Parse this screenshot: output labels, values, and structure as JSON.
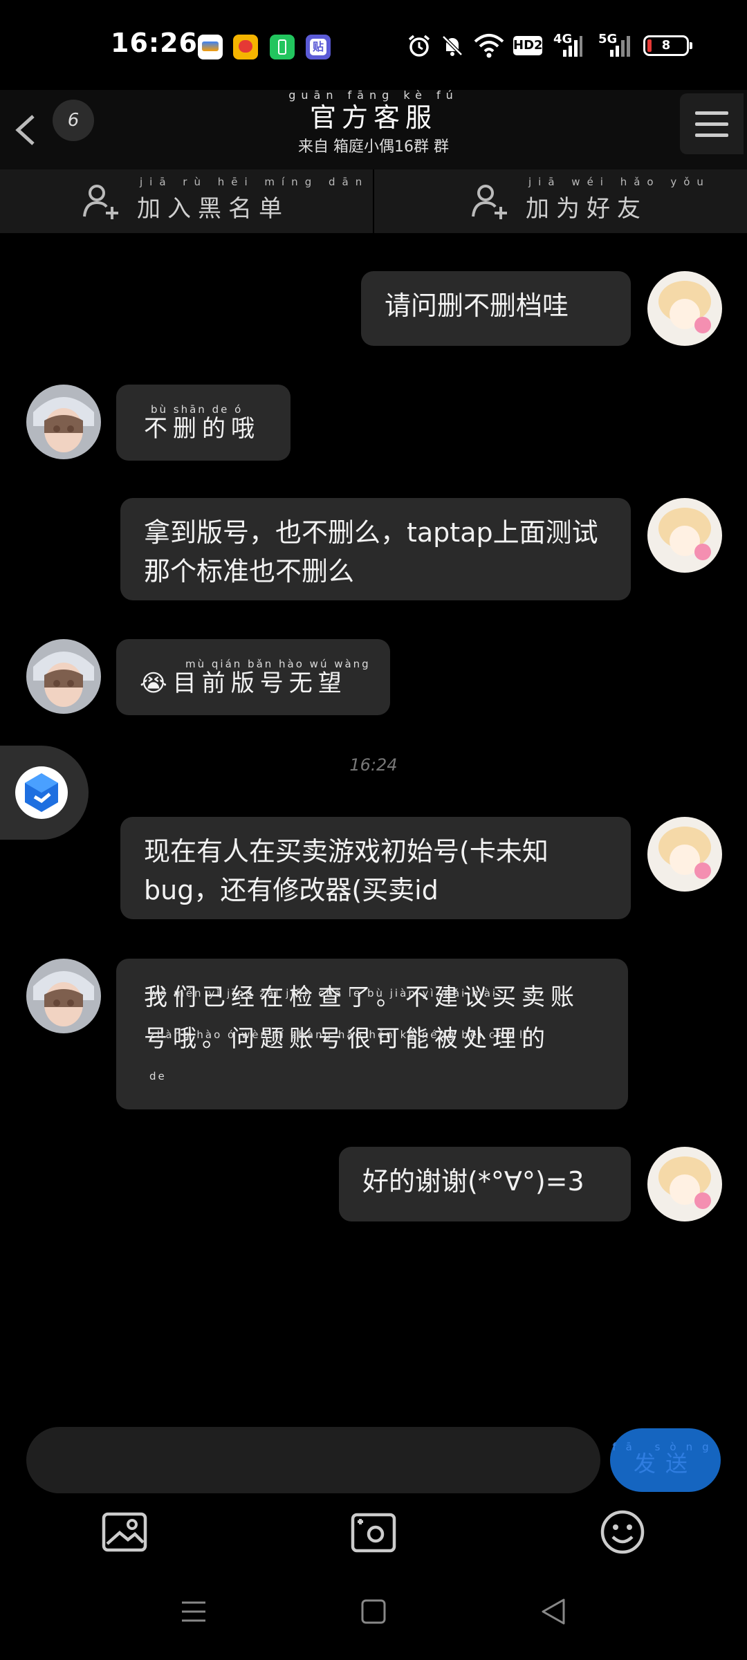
{
  "status_bar": {
    "time": "16:26",
    "battery": "8",
    "network_1": "4G",
    "network_2": "5G",
    "hd": "HD2",
    "app_icons": [
      "wallet-app-icon",
      "weibo-app-icon",
      "battery-app-icon",
      "tieba-app-icon"
    ]
  },
  "header": {
    "unread_count": "6",
    "title_ruby": "guān fāng kè fú",
    "title": "官方客服",
    "subtitle": "来自 箱庭小偶16群 群"
  },
  "actions": {
    "blacklist_ruby": "jiā rù hēi míng dān",
    "blacklist_label": "加入黑名单",
    "friend_ruby": "jiā wéi hǎo yǒu",
    "friend_label": "加为好友"
  },
  "messages": [
    {
      "from": "user",
      "text": "请问删不删档哇"
    },
    {
      "from": "agent",
      "ruby": "bù shān de ó",
      "text": "不删的哦"
    },
    {
      "from": "user",
      "text": "拿到版号，也不删么，taptap上面测试那个标准也不删么"
    },
    {
      "from": "agent",
      "ruby": "mù qián bǎn hào wú wàng",
      "text": "目前版号无望",
      "emoji": "😭"
    },
    {
      "from": "user",
      "text": "现在有人在买卖游戏初始号(卡未知bug，还有修改器(买卖id"
    },
    {
      "from": "agent",
      "text": "我们已经在检查了。不建议买卖账号哦。问题账号很可能被处理的",
      "ruby_lines": [
        "wǒ mén yǐ jīng zài jiān chá le    bù jiàn yì mǎi mài",
        "zhàng hào ó    wèn tí zhàng hào hěn kě néng bèi chǔ lǐ",
        "de"
      ]
    },
    {
      "from": "user",
      "text": "好的谢谢(*°∀°)=3"
    }
  ],
  "time_separator": "16:24",
  "input": {
    "placeholder": "",
    "send_ruby": "fā sòng",
    "send_label": "发送"
  },
  "toolbar": [
    "image-icon",
    "camera-icon",
    "emoji-icon"
  ],
  "nav": [
    "menu-icon",
    "home-icon",
    "back-icon"
  ],
  "colors": {
    "accent": "#1565c0",
    "bubble": "#2a2a2a",
    "background": "#000000"
  }
}
